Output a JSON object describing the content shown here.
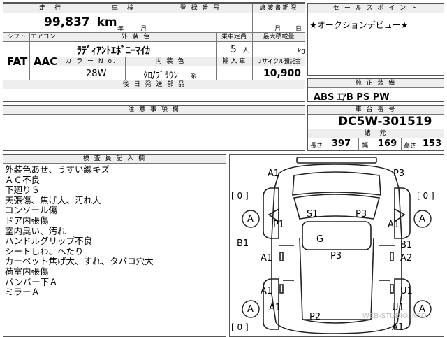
{
  "top_strip": "",
  "mileage": {
    "header": "走　行",
    "value": "99,837",
    "unit": "km"
  },
  "inspection": {
    "header": "車　検",
    "year_label": "年",
    "month_label": "月"
  },
  "registration": {
    "header": "登 録 番 号",
    "value": ""
  },
  "transfer": {
    "header": "譲渡書期限",
    "month_label": "月",
    "day_label": "日"
  },
  "shift": {
    "header": "シフト",
    "value": "FAT"
  },
  "aircon": {
    "header": "エアコン",
    "value": "AAC"
  },
  "exterior_color": {
    "header": "外 装 色",
    "value": "ﾗﾃﾞｨｱﾝﾄｴﾎﾞﾆｰﾏｲｶ"
  },
  "capacity": {
    "header": "乗車定員",
    "value": "5",
    "unit": "人"
  },
  "max_load": {
    "header": "最大積載量",
    "unit": "kg"
  },
  "color_no": {
    "header": "カ ラ ー N o.",
    "value": "28W"
  },
  "interior_color": {
    "header": "内 装 色",
    "value": "ｸﾛ/ﾌﾞﾗｳﾝ",
    "suffix": "系"
  },
  "import": {
    "header": "輸 入 車"
  },
  "recycle": {
    "header": "リサイクル預託金",
    "value": "10,900",
    "unit": "円"
  },
  "later_parts": {
    "header": "後 日 発 送 部 品"
  },
  "sales_point": {
    "header": "セ ー ル ス ポ イ ン ト",
    "text": "★オークションデビュー★"
  },
  "equipment": {
    "header": "純 正 装 備",
    "value": "ABS ｴｱB PS PW"
  },
  "caution": {
    "header": "注 意 事 項 欄"
  },
  "chassis": {
    "header": "車 台 番 号",
    "value": "DC5W-301519"
  },
  "dimensions": {
    "header": "諸　元",
    "length_label": "長さ",
    "length": "397",
    "width_label": "幅",
    "width": "169",
    "height_label": "高さ",
    "height": "153"
  },
  "inspector": {
    "header": "検 査 員 記 入 欄",
    "notes": [
      "外装色あせ、うすい線キズ",
      "ＡＣ不良",
      "下廻りＳ",
      "天張傷、焦げ大、汚れ大",
      "コンソール傷",
      "ドア内張傷",
      "室内臭い、汚れ",
      "ハンドルグリップ不良",
      "シートしわ、へたり",
      "カーペット焦げ大、すれ、タバコ穴大",
      "荷室内張傷",
      "バンパー下Ａ",
      "ミラーＡ"
    ]
  },
  "diagram": {
    "labels": {
      "a1_tl": "A1",
      "p3_tr": "P3",
      "bracket_l": "[ 0 ]",
      "bracket_r": "[ 0 ]",
      "s1": "S1",
      "p3_roof": "P3",
      "wheel_fl": "A",
      "wheel_fr": "A",
      "wheel_rl": "A",
      "wheel_rr": "A",
      "p1": "P1",
      "a1_rside": "A1",
      "g": "G",
      "b1_l": "B1",
      "b1_r": "B1",
      "p3_floor": "P3",
      "a1_l1": "A1",
      "a2_r": "A2",
      "a1_l2": "A1",
      "u1_r1": "U1",
      "a1_l3": "A1",
      "u1_r2": "U1",
      "p2": "P2",
      "a1_bottom": "A1",
      "bracket_bl": "[ 0 ]"
    },
    "watermark": "WEB-STUDIO.INFO"
  }
}
